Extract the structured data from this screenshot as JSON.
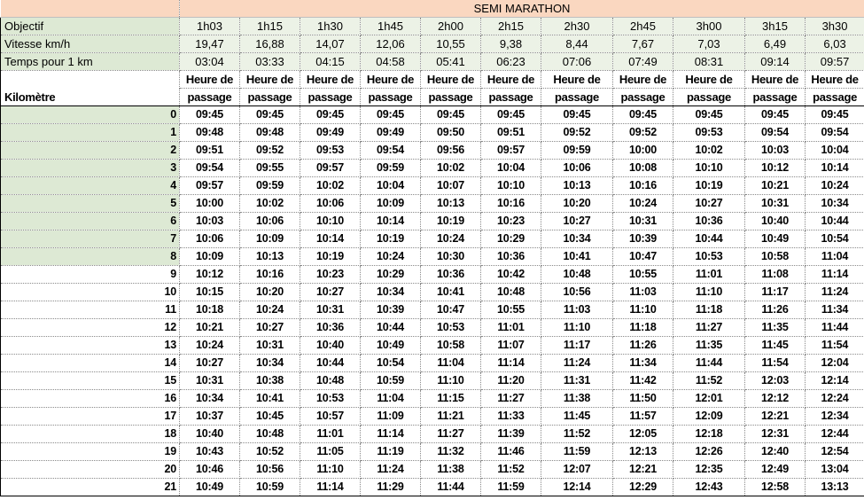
{
  "sheet": {
    "title": "SEMI MARATHON",
    "objectif_label": "Objectif",
    "vitesse_label": "Vitesse km/h",
    "temps_label": "Temps pour 1 km",
    "kilometre_label": "Kilomètre",
    "col_header_line1": "Heure de",
    "col_header_line2": "passage",
    "objectifs": [
      "1h03",
      "1h15",
      "1h30",
      "1h45",
      "2h00",
      "2h15",
      "2h30",
      "2h45",
      "3h00",
      "3h15",
      "3h30"
    ],
    "vitesses": [
      "19,47",
      "16,88",
      "14,07",
      "12,06",
      "10,55",
      "9,38",
      "8,44",
      "7,67",
      "7,03",
      "6,49",
      "6,03"
    ],
    "temps_km": [
      "03:04",
      "03:33",
      "04:15",
      "04:58",
      "05:41",
      "06:23",
      "07:06",
      "07:49",
      "08:31",
      "09:14",
      "09:57"
    ],
    "shaded_km_count": 9,
    "rows": [
      {
        "km": "0",
        "times": [
          "09:45",
          "09:45",
          "09:45",
          "09:45",
          "09:45",
          "09:45",
          "09:45",
          "09:45",
          "09:45",
          "09:45",
          "09:45"
        ]
      },
      {
        "km": "1",
        "times": [
          "09:48",
          "09:48",
          "09:49",
          "09:49",
          "09:50",
          "09:51",
          "09:52",
          "09:52",
          "09:53",
          "09:54",
          "09:54"
        ]
      },
      {
        "km": "2",
        "times": [
          "09:51",
          "09:52",
          "09:53",
          "09:54",
          "09:56",
          "09:57",
          "09:59",
          "10:00",
          "10:02",
          "10:03",
          "10:04"
        ]
      },
      {
        "km": "3",
        "times": [
          "09:54",
          "09:55",
          "09:57",
          "09:59",
          "10:02",
          "10:04",
          "10:06",
          "10:08",
          "10:10",
          "10:12",
          "10:14"
        ]
      },
      {
        "km": "4",
        "times": [
          "09:57",
          "09:59",
          "10:02",
          "10:04",
          "10:07",
          "10:10",
          "10:13",
          "10:16",
          "10:19",
          "10:21",
          "10:24"
        ]
      },
      {
        "km": "5",
        "times": [
          "10:00",
          "10:02",
          "10:06",
          "10:09",
          "10:13",
          "10:16",
          "10:20",
          "10:24",
          "10:27",
          "10:31",
          "10:34"
        ]
      },
      {
        "km": "6",
        "times": [
          "10:03",
          "10:06",
          "10:10",
          "10:14",
          "10:19",
          "10:23",
          "10:27",
          "10:31",
          "10:36",
          "10:40",
          "10:44"
        ]
      },
      {
        "km": "7",
        "times": [
          "10:06",
          "10:09",
          "10:14",
          "10:19",
          "10:24",
          "10:29",
          "10:34",
          "10:39",
          "10:44",
          "10:49",
          "10:54"
        ]
      },
      {
        "km": "8",
        "times": [
          "10:09",
          "10:13",
          "10:19",
          "10:24",
          "10:30",
          "10:36",
          "10:41",
          "10:47",
          "10:53",
          "10:58",
          "11:04"
        ]
      },
      {
        "km": "9",
        "times": [
          "10:12",
          "10:16",
          "10:23",
          "10:29",
          "10:36",
          "10:42",
          "10:48",
          "10:55",
          "11:01",
          "11:08",
          "11:14"
        ]
      },
      {
        "km": "10",
        "times": [
          "10:15",
          "10:20",
          "10:27",
          "10:34",
          "10:41",
          "10:48",
          "10:56",
          "11:03",
          "11:10",
          "11:17",
          "11:24"
        ]
      },
      {
        "km": "11",
        "times": [
          "10:18",
          "10:24",
          "10:31",
          "10:39",
          "10:47",
          "10:55",
          "11:03",
          "11:10",
          "11:18",
          "11:26",
          "11:34"
        ]
      },
      {
        "km": "12",
        "times": [
          "10:21",
          "10:27",
          "10:36",
          "10:44",
          "10:53",
          "11:01",
          "11:10",
          "11:18",
          "11:27",
          "11:35",
          "11:44"
        ]
      },
      {
        "km": "13",
        "times": [
          "10:24",
          "10:31",
          "10:40",
          "10:49",
          "10:58",
          "11:07",
          "11:17",
          "11:26",
          "11:35",
          "11:45",
          "11:54"
        ]
      },
      {
        "km": "14",
        "times": [
          "10:27",
          "10:34",
          "10:44",
          "10:54",
          "11:04",
          "11:14",
          "11:24",
          "11:34",
          "11:44",
          "11:54",
          "12:04"
        ]
      },
      {
        "km": "15",
        "times": [
          "10:31",
          "10:38",
          "10:48",
          "10:59",
          "11:10",
          "11:20",
          "11:31",
          "11:42",
          "11:52",
          "12:03",
          "12:14"
        ]
      },
      {
        "km": "16",
        "times": [
          "10:34",
          "10:41",
          "10:53",
          "11:04",
          "11:15",
          "11:27",
          "11:38",
          "11:50",
          "12:01",
          "12:12",
          "12:24"
        ]
      },
      {
        "km": "17",
        "times": [
          "10:37",
          "10:45",
          "10:57",
          "11:09",
          "11:21",
          "11:33",
          "11:45",
          "11:57",
          "12:09",
          "12:21",
          "12:34"
        ]
      },
      {
        "km": "18",
        "times": [
          "10:40",
          "10:48",
          "11:01",
          "11:14",
          "11:27",
          "11:39",
          "11:52",
          "12:05",
          "12:18",
          "12:31",
          "12:44"
        ]
      },
      {
        "km": "19",
        "times": [
          "10:43",
          "10:52",
          "11:05",
          "11:19",
          "11:32",
          "11:46",
          "11:59",
          "12:13",
          "12:26",
          "12:40",
          "12:54"
        ]
      },
      {
        "km": "20",
        "times": [
          "10:46",
          "10:56",
          "11:10",
          "11:24",
          "11:38",
          "11:52",
          "12:07",
          "12:21",
          "12:35",
          "12:49",
          "13:04"
        ]
      },
      {
        "km": "21",
        "times": [
          "10:49",
          "10:59",
          "11:14",
          "11:29",
          "11:44",
          "11:59",
          "12:14",
          "12:29",
          "12:43",
          "12:58",
          "13:13"
        ]
      }
    ]
  }
}
